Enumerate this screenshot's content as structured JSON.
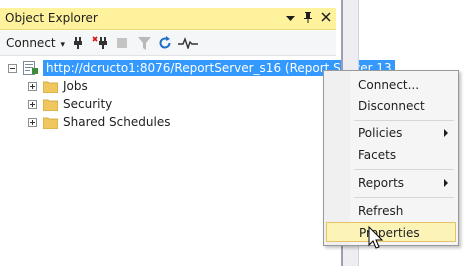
{
  "panel": {
    "title": "Object Explorer",
    "connect_label": "Connect",
    "title_icons": [
      "chevron-down-icon",
      "pin-icon",
      "close-icon"
    ]
  },
  "toolbar": {
    "icons": [
      "connect-icon",
      "disconnect-icon",
      "stop-icon",
      "filter-icon",
      "refresh-icon",
      "activity-monitor-icon"
    ]
  },
  "tree": {
    "server": "http://dcructo1:8076/ReportServer_s16 (Report Server 13",
    "children": [
      {
        "label": "Jobs"
      },
      {
        "label": "Security"
      },
      {
        "label": "Shared Schedules"
      }
    ]
  },
  "menu": {
    "items": [
      {
        "label": "Connect...",
        "submenu": false
      },
      {
        "label": "Disconnect",
        "submenu": false
      },
      {
        "label": "Policies",
        "submenu": true
      },
      {
        "label": "Facets",
        "submenu": false
      },
      {
        "label": "Reports",
        "submenu": true
      },
      {
        "label": "Refresh",
        "submenu": false
      },
      {
        "label": "Properties",
        "submenu": false,
        "highlighted": true
      }
    ]
  },
  "colors": {
    "title_bar": "#fff29d",
    "selection": "#3399ff",
    "menu_hover": "#fcf3b7"
  }
}
